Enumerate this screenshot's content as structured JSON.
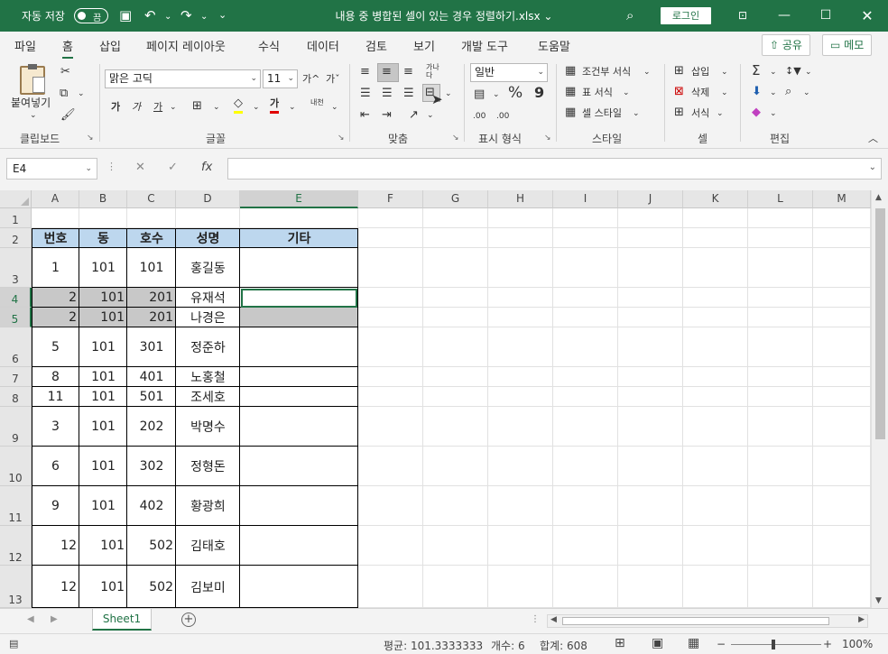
{
  "titlebar": {
    "autosave_label": "자동 저장",
    "autosave_state": "끔",
    "doc_title": "내용 중 병합된 셀이 있는 경우 정렬하기.xlsx ⌄",
    "login": "로그인",
    "icons": [
      "save-icon",
      "undo-icon",
      "redo-icon",
      "customize-icon",
      "search-icon",
      "ribbon-display-icon",
      "minimize-icon",
      "maximize-icon",
      "close-icon"
    ],
    "accent": "#217346"
  },
  "tabs": {
    "items": [
      "파일",
      "홈",
      "삽입",
      "페이지 레이아웃",
      "수식",
      "데이터",
      "검토",
      "보기",
      "개발 도구",
      "도움말"
    ],
    "active": "홈",
    "share": "공유",
    "memo": "메모"
  },
  "ribbon": {
    "clipboard": {
      "paste": "붙여넣기",
      "label": "클립보드"
    },
    "font": {
      "name": "맑은 고딕",
      "size": "11",
      "bold": "가",
      "italic": "가",
      "underline": "가",
      "grow": "가^",
      "shrink": "가ˇ",
      "phonetic": "내천",
      "label": "글꼴",
      "color_a": "가"
    },
    "align": {
      "label": "맞춤",
      "wrap": "가나다"
    },
    "number": {
      "format": "일반",
      "percent": "%",
      "comma": "9",
      "label": "표시 형식",
      "inc": ".00",
      "dec": ".00"
    },
    "styles": {
      "conditional": "조건부 서식",
      "table": "표 서식",
      "cell": "셀 스타일",
      "label": "스타일"
    },
    "cells": {
      "insert": "삽입",
      "delete": "삭제",
      "format": "서식",
      "label": "셀"
    },
    "editing": {
      "label": "편집",
      "sum": "Σ"
    }
  },
  "formula_bar": {
    "name_box": "E4",
    "formula": ""
  },
  "grid": {
    "columns": [
      "A",
      "B",
      "C",
      "D",
      "E",
      "F",
      "G",
      "H",
      "I",
      "J",
      "K",
      "L",
      "M"
    ],
    "active_column": "E",
    "rows": [
      "1",
      "2",
      "3",
      "4",
      "5",
      "6",
      "7",
      "8",
      "9",
      "10",
      "11",
      "12",
      "13"
    ],
    "active_rows": [
      "4",
      "5"
    ],
    "header": [
      "번호",
      "동",
      "호수",
      "성명",
      "기타"
    ],
    "data": [
      [
        "1",
        "101",
        "101",
        "홍길동",
        ""
      ],
      [
        "2",
        "101",
        "201",
        "유재석",
        ""
      ],
      [
        "2",
        "101",
        "201",
        "나경은",
        ""
      ],
      [
        "5",
        "101",
        "301",
        "정준하",
        ""
      ],
      [
        "8",
        "101",
        "401",
        "노홍철",
        ""
      ],
      [
        "11",
        "101",
        "501",
        "조세호",
        ""
      ],
      [
        "3",
        "101",
        "202",
        "박명수",
        ""
      ],
      [
        "6",
        "101",
        "302",
        "정형돈",
        ""
      ],
      [
        "9",
        "101",
        "402",
        "황광희",
        ""
      ],
      [
        "12",
        "101",
        "502",
        "김태호",
        ""
      ],
      [
        "12",
        "101",
        "502",
        "김보미",
        ""
      ]
    ],
    "header_fill": "#bdd7ee",
    "selection_fill": "#c8c8c8"
  },
  "sheets": {
    "tabs": [
      "Sheet1"
    ],
    "active": "Sheet1"
  },
  "status": {
    "average": "평균: 101.3333333",
    "count": "개수: 6",
    "sum": "합계: 608",
    "zoom": "100%",
    "minus": "−",
    "plus": "+"
  }
}
